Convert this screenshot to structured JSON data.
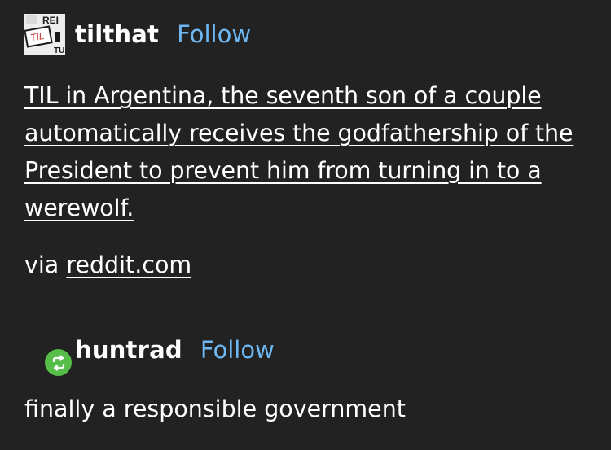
{
  "post": {
    "username": "tilthat",
    "follow_label": "Follow",
    "avatar_text": {
      "top": "REI",
      "middle": "TIL",
      "bottom": "TU"
    },
    "body_lines": [
      "TIL in Argentina, the seventh son of a couple",
      "automatically receives the godfathership of the",
      "President to prevent him from turning in to a",
      "werewolf."
    ],
    "via_prefix": "via",
    "via_link": "reddit.com"
  },
  "reblog": {
    "username": "huntrad",
    "follow_label": "Follow",
    "text": "finally a responsible government"
  },
  "colors": {
    "background": "#222222",
    "text": "#ffffff",
    "follow": "#6db7f2",
    "reblog_badge": "#56bd49",
    "divider": "#3a3a3a"
  },
  "icons": {
    "reblog": "reblog-icon",
    "avatar": "tilthat-avatar"
  }
}
